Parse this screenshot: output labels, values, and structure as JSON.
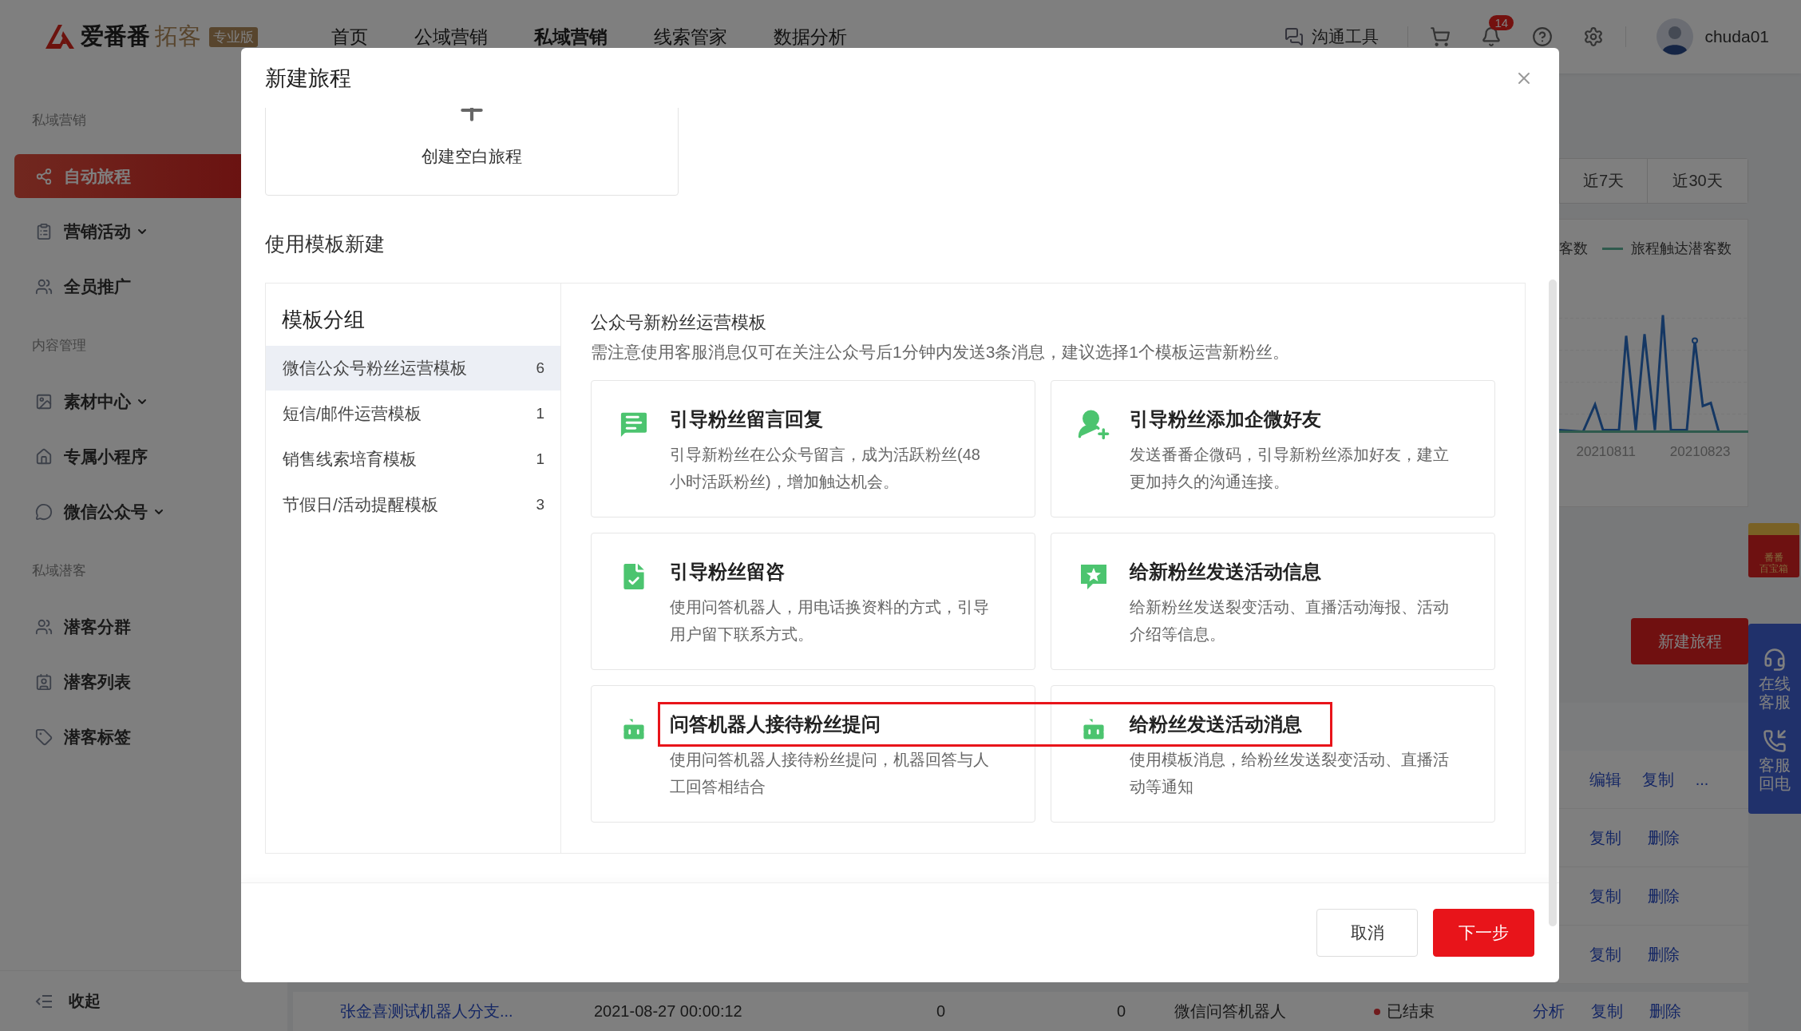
{
  "header": {
    "logo": {
      "brand": "爱番番",
      "product": "拓客",
      "edition": "专业版"
    },
    "nav": [
      {
        "label": "首页",
        "selected": false
      },
      {
        "label": "公域营销",
        "selected": false
      },
      {
        "label": "私域营销",
        "selected": true
      },
      {
        "label": "线索管家",
        "selected": false
      },
      {
        "label": "数据分析",
        "selected": false
      }
    ],
    "tools": {
      "chat": "沟通工具",
      "notifications": "14",
      "user": "chuda01"
    }
  },
  "sidebar": {
    "sections": [
      {
        "title": "私域营销",
        "items": [
          {
            "label": "自动旅程",
            "selected": true,
            "dropdown": false
          },
          {
            "label": "营销活动",
            "selected": false,
            "dropdown": true
          },
          {
            "label": "全员推广",
            "selected": false,
            "dropdown": false
          }
        ]
      },
      {
        "title": "内容管理",
        "items": [
          {
            "label": "素材中心",
            "selected": false,
            "dropdown": true
          },
          {
            "label": "专属小程序",
            "selected": false,
            "dropdown": false
          },
          {
            "label": "微信公众号",
            "selected": false,
            "dropdown": true
          }
        ]
      },
      {
        "title": "私域潜客",
        "items": [
          {
            "label": "潜客分群",
            "selected": false,
            "dropdown": false
          },
          {
            "label": "潜客列表",
            "selected": false,
            "dropdown": false
          },
          {
            "label": "潜客标签",
            "selected": false,
            "dropdown": false
          }
        ]
      }
    ],
    "collapse": "收起"
  },
  "page": {
    "range_tabs": [
      {
        "label": "近7天",
        "selected": false
      },
      {
        "label": "近30天",
        "selected": false
      }
    ],
    "chart": {
      "legend": [
        "客数",
        "旅程触达潜客数"
      ],
      "x_labels": [
        "20210811",
        "20210823"
      ]
    },
    "new_button": "新建旅程",
    "table": {
      "rows": [
        {
          "actions": [
            "编辑",
            "复制",
            "..."
          ]
        },
        {
          "actions": [
            "复制",
            "删除"
          ]
        },
        {
          "actions": [
            "复制",
            "删除"
          ]
        },
        {
          "actions": [
            "复制",
            "删除"
          ]
        }
      ],
      "last_row": {
        "name": "张金喜测试机器人分支...",
        "created": "2021-08-27 00:00:12",
        "column_3": "0",
        "column_4": "0",
        "type": "微信问答机器人",
        "status": "已结束",
        "actions": [
          "分析",
          "复制",
          "删除"
        ]
      }
    }
  },
  "widgets": {
    "gift": [
      "番番",
      "百宝箱"
    ],
    "service": [
      "在线客服",
      "客服回电"
    ]
  },
  "modal": {
    "title": "新建旅程",
    "blank": {
      "label": "创建空白旅程"
    },
    "template_heading": "使用模板新建",
    "groups": {
      "title": "模板分组",
      "items": [
        {
          "label": "微信公众号粉丝运营模板",
          "count": "6",
          "selected": true
        },
        {
          "label": "短信/邮件运营模板",
          "count": "1",
          "selected": false
        },
        {
          "label": "销售线索培育模板",
          "count": "1",
          "selected": false
        },
        {
          "label": "节假日/活动提醒模板",
          "count": "3",
          "selected": false
        }
      ]
    },
    "section": {
      "title": "公众号新粉丝运营模板",
      "note": "需注意使用客服消息仅可在关注公众号后1分钟内发送3条消息，建议选择1个模板运营新粉丝。"
    },
    "templates": [
      {
        "title": "引导粉丝留言回复",
        "description": "引导新粉丝在公众号留言，成为活跃粉丝(48小时活跃粉丝)，增加触达机会。",
        "highlighted": false
      },
      {
        "title": "引导粉丝添加企微好友",
        "description": "发送番番企微码，引导新粉丝添加好友，建立更加持久的沟通连接。",
        "highlighted": false
      },
      {
        "title": "引导粉丝留咨",
        "description": "使用问答机器人，用电话换资料的方式，引导用户留下联系方式。",
        "highlighted": false
      },
      {
        "title": "给新粉丝发送活动信息",
        "description": "给新粉丝发送裂变活动、直播活动海报、活动介绍等信息。",
        "highlighted": false
      },
      {
        "title": "问答机器人接待粉丝提问",
        "description": "使用问答机器人接待粉丝提问，机器回答与人工回答相结合",
        "highlighted": true
      },
      {
        "title": "给粉丝发送活动消息",
        "description": "使用模板消息，给粉丝发送裂变活动、直播活动等通知",
        "highlighted": true
      }
    ],
    "buttons": [
      {
        "label": "取消",
        "kind": "secondary"
      },
      {
        "label": "下一步",
        "kind": "primary"
      }
    ]
  }
}
